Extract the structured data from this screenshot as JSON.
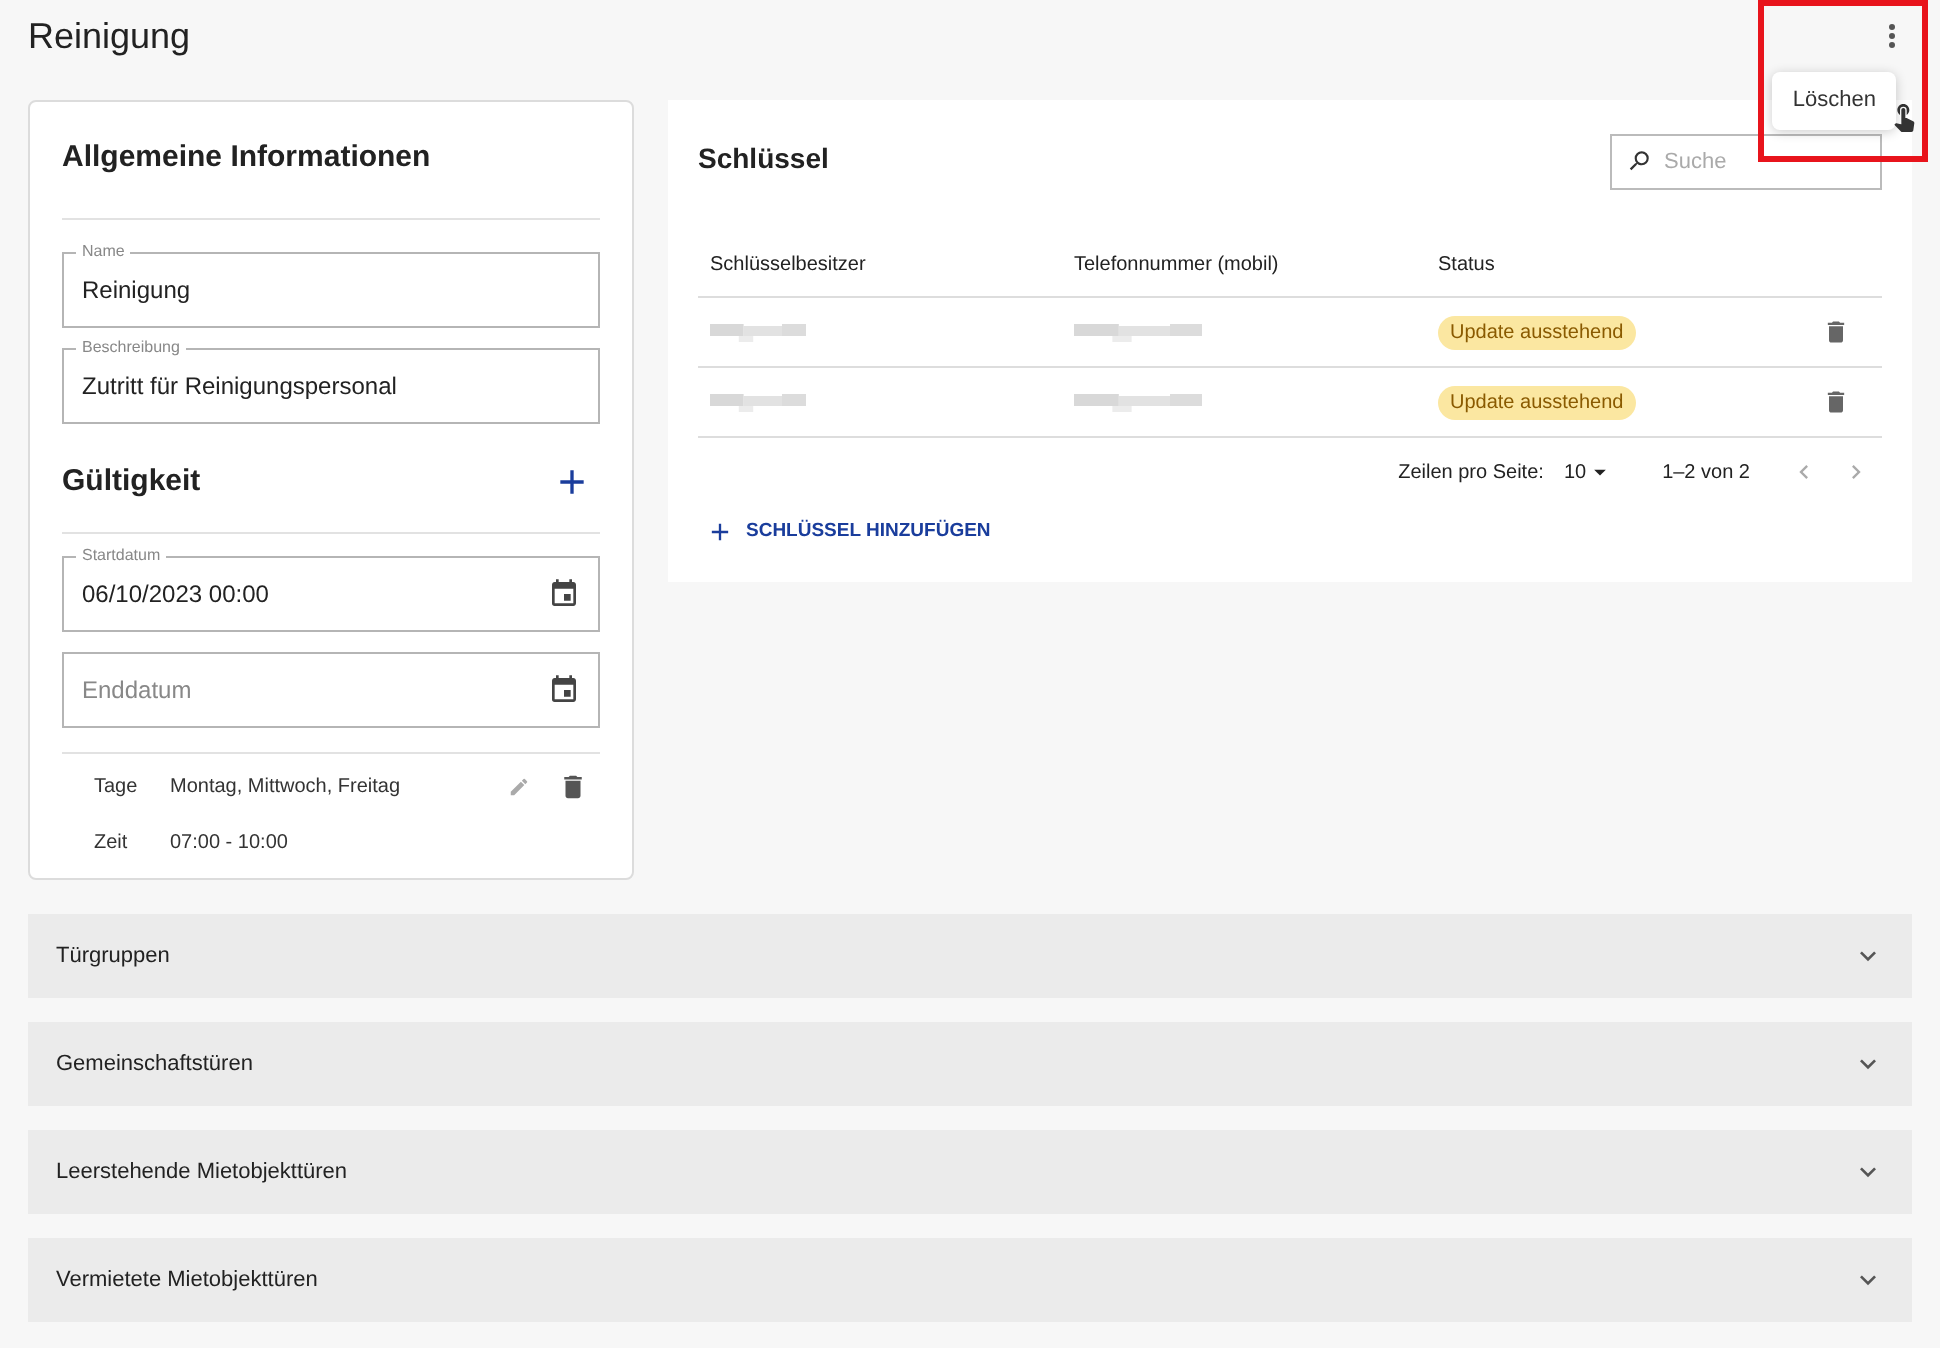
{
  "page_title": "Reinigung",
  "menu": {
    "items": [
      {
        "label": "Löschen"
      }
    ]
  },
  "general": {
    "title": "Allgemeine Informationen",
    "fields": [
      {
        "label": "Name",
        "value": "Reinigung"
      },
      {
        "label": "Beschreibung",
        "value": "Zutritt für Reinigungspersonal"
      }
    ]
  },
  "validity": {
    "title": "Gültigkeit",
    "start": {
      "label": "Startdatum",
      "value": "06/10/2023 00:00"
    },
    "end": {
      "placeholder": "Enddatum"
    },
    "schedule": [
      {
        "label": "Tage",
        "value": "Montag, Mittwoch, Freitag"
      },
      {
        "label": "Zeit",
        "value": "07:00 - 10:00"
      }
    ]
  },
  "keys": {
    "title": "Schlüssel",
    "search": {
      "placeholder": "Suche"
    },
    "columns": [
      "Schlüsselbesitzer",
      "Telefonnummer (mobil)",
      "Status"
    ],
    "rows": [
      {
        "status": "Update ausstehend"
      },
      {
        "status": "Update ausstehend"
      }
    ],
    "pagination": {
      "rows_label": "Zeilen pro Seite:",
      "rows_value": "10",
      "range": "1–2 von 2"
    },
    "add_button": "SCHLÜSSEL HINZUFÜGEN"
  },
  "sections": [
    {
      "title": "Türgruppen",
      "expanded": false
    },
    {
      "title": "Gemeinschaftstüren",
      "expanded": false
    },
    {
      "title": "Leerstehende Mietobjekttüren",
      "expanded": false
    },
    {
      "title": "Vermietete Mietobjekttüren",
      "expanded": false
    }
  ]
}
